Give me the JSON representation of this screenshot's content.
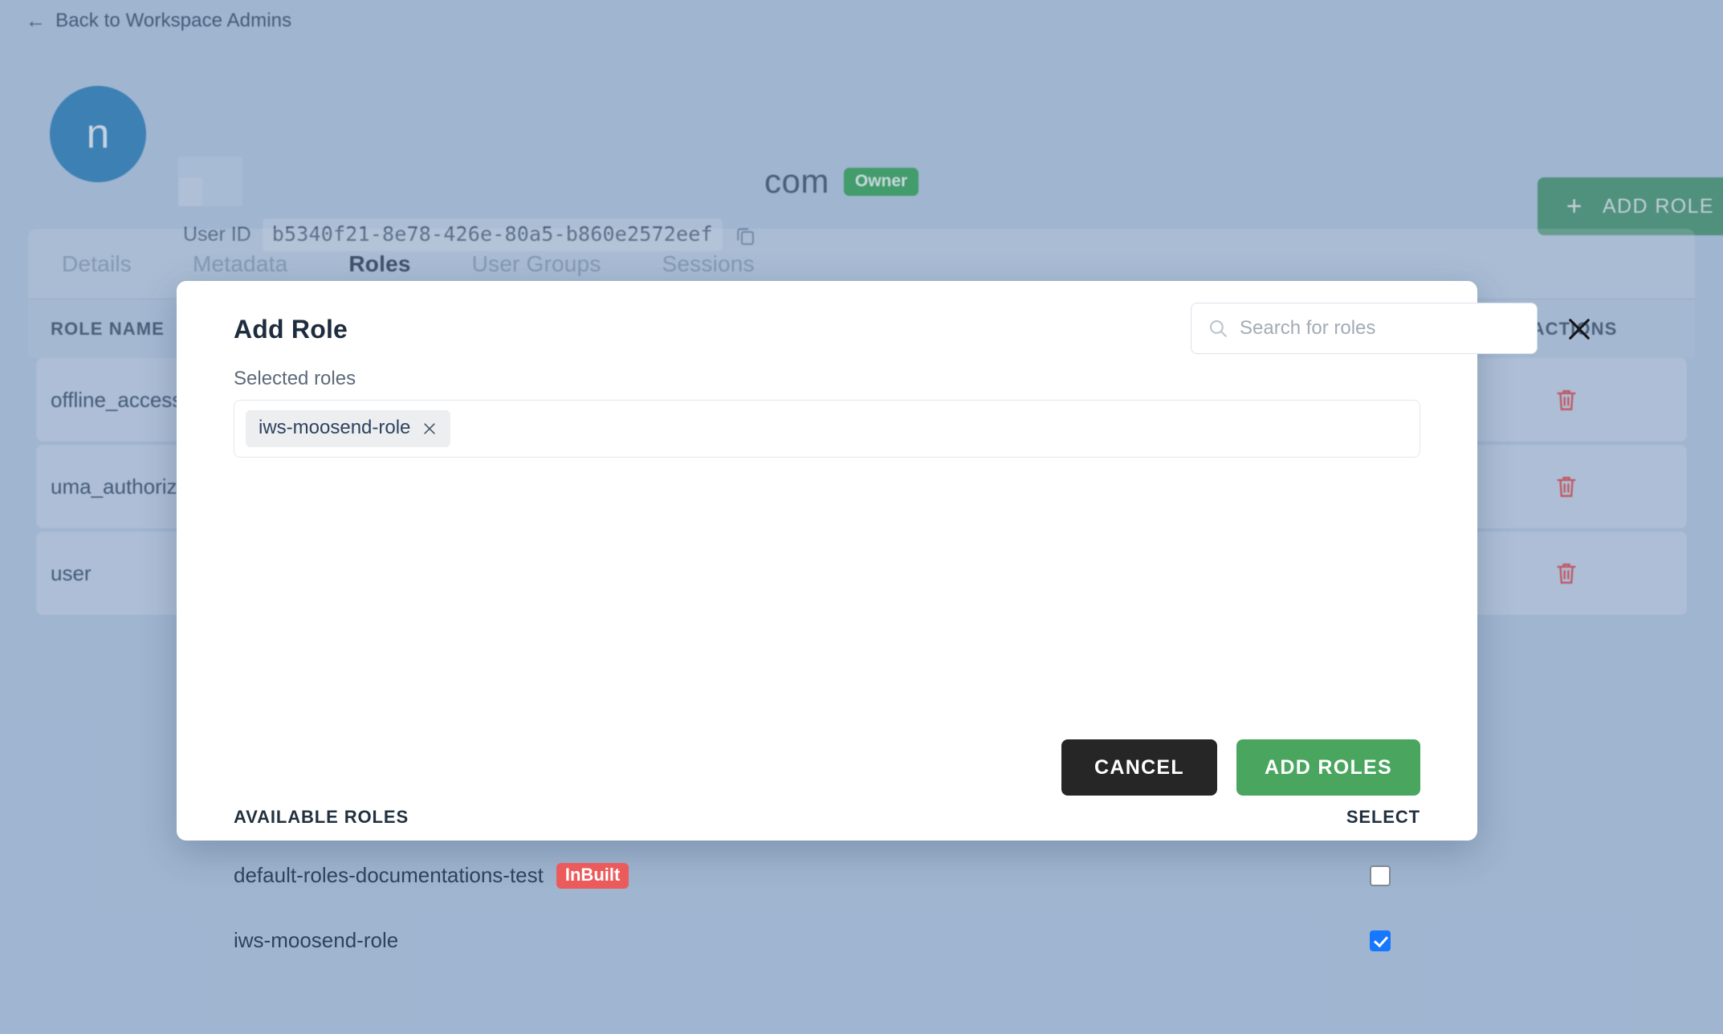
{
  "back_link": {
    "label": "Back to Workspace Admins",
    "icon": "arrow-left-icon"
  },
  "user_header": {
    "avatar_initial": "n",
    "org_title": "com",
    "owner_badge": "Owner",
    "user_id_label": "User ID",
    "user_id_value": "b5340f21-8e78-426e-80a5-b860e2572eef",
    "copy_icon": "copy-icon"
  },
  "top_actions": {
    "add_role_label": "ADD ROLE",
    "add_role_icon": "plus-icon"
  },
  "tabs": [
    {
      "label": "Details",
      "active": false
    },
    {
      "label": "Metadata",
      "active": false
    },
    {
      "label": "Roles",
      "active": true
    },
    {
      "label": "User Groups",
      "active": false
    },
    {
      "label": "Sessions",
      "active": false
    }
  ],
  "roles_table": {
    "columns": [
      "ROLE NAME",
      "ACTIONS"
    ],
    "rows": [
      {
        "name": "offline_access",
        "action_icon": "trash-icon"
      },
      {
        "name": "uma_authorization",
        "action_icon": "trash-icon"
      },
      {
        "name": "user",
        "action_icon": "trash-icon"
      }
    ]
  },
  "modal": {
    "title": "Add Role",
    "search": {
      "placeholder": "Search for roles",
      "value": "",
      "icon": "search-icon"
    },
    "close_icon": "close-icon",
    "selected_roles_label": "Selected roles",
    "selected_roles": [
      {
        "label": "iws-moosend-role",
        "remove_icon": "close-icon"
      }
    ],
    "available_header": "AVAILABLE ROLES",
    "select_header": "SELECT",
    "available_roles": [
      {
        "name": "default-roles-documentations-test",
        "badge": "InBuilt",
        "checked": false
      },
      {
        "name": "iws-moosend-role",
        "badge": "",
        "checked": true
      }
    ],
    "cancel_label": "CANCEL",
    "submit_label": "ADD ROLES"
  },
  "colors": {
    "page_background": "#b2c4dd",
    "accent_green": "#4aa55f",
    "owner_green": "#2ba14d",
    "inbuilt_red": "#ec5b5b",
    "checkbox_blue": "#1677ff",
    "avatar_blue": "#2479b5",
    "delete_red": "#e03e3e"
  }
}
